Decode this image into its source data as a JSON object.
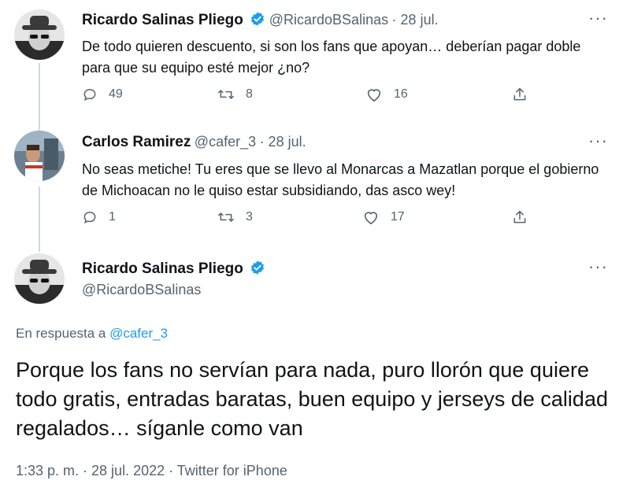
{
  "tweets": [
    {
      "name": "Ricardo Salinas Pliego",
      "handle": "@RicardoBSalinas",
      "date": "· 28 jul.",
      "text": "De todo quieren descuento, si son los fans que apoyan… deberían pagar doble para que su equipo esté mejor ¿no?",
      "replies": "49",
      "retweets": "8",
      "likes": "16"
    },
    {
      "name": "Carlos Ramirez",
      "handle": "@cafer_3",
      "date": "· 28 jul.",
      "text": "No seas metiche! Tu eres que se llevo al Monarcas a Mazatlan porque el gobierno de Michoacan no le quiso estar subsidiando, das asco wey!",
      "replies": "1",
      "retweets": "3",
      "likes": "17"
    }
  ],
  "main_tweet": {
    "name": "Ricardo Salinas Pliego",
    "handle": "@RicardoBSalinas",
    "reply_prefix": "En respuesta a",
    "reply_handle": "@cafer_3",
    "text": "Porque los fans no servían para nada, puro llorón que quiere todo gratis, entradas baratas, buen equipo y jerseys de calidad regalados… síganle como van",
    "timestamp": "1:33 p. m. · 28 jul. 2022 · Twitter for iPhone"
  },
  "more_label": "···",
  "colors": {
    "accent": "#1d9bf0",
    "muted": "#536471",
    "text": "#0f1419",
    "line": "#cfd9de"
  },
  "icons": [
    "verified-badge-icon",
    "reply-icon",
    "retweet-icon",
    "like-icon",
    "share-icon",
    "more-icon"
  ]
}
